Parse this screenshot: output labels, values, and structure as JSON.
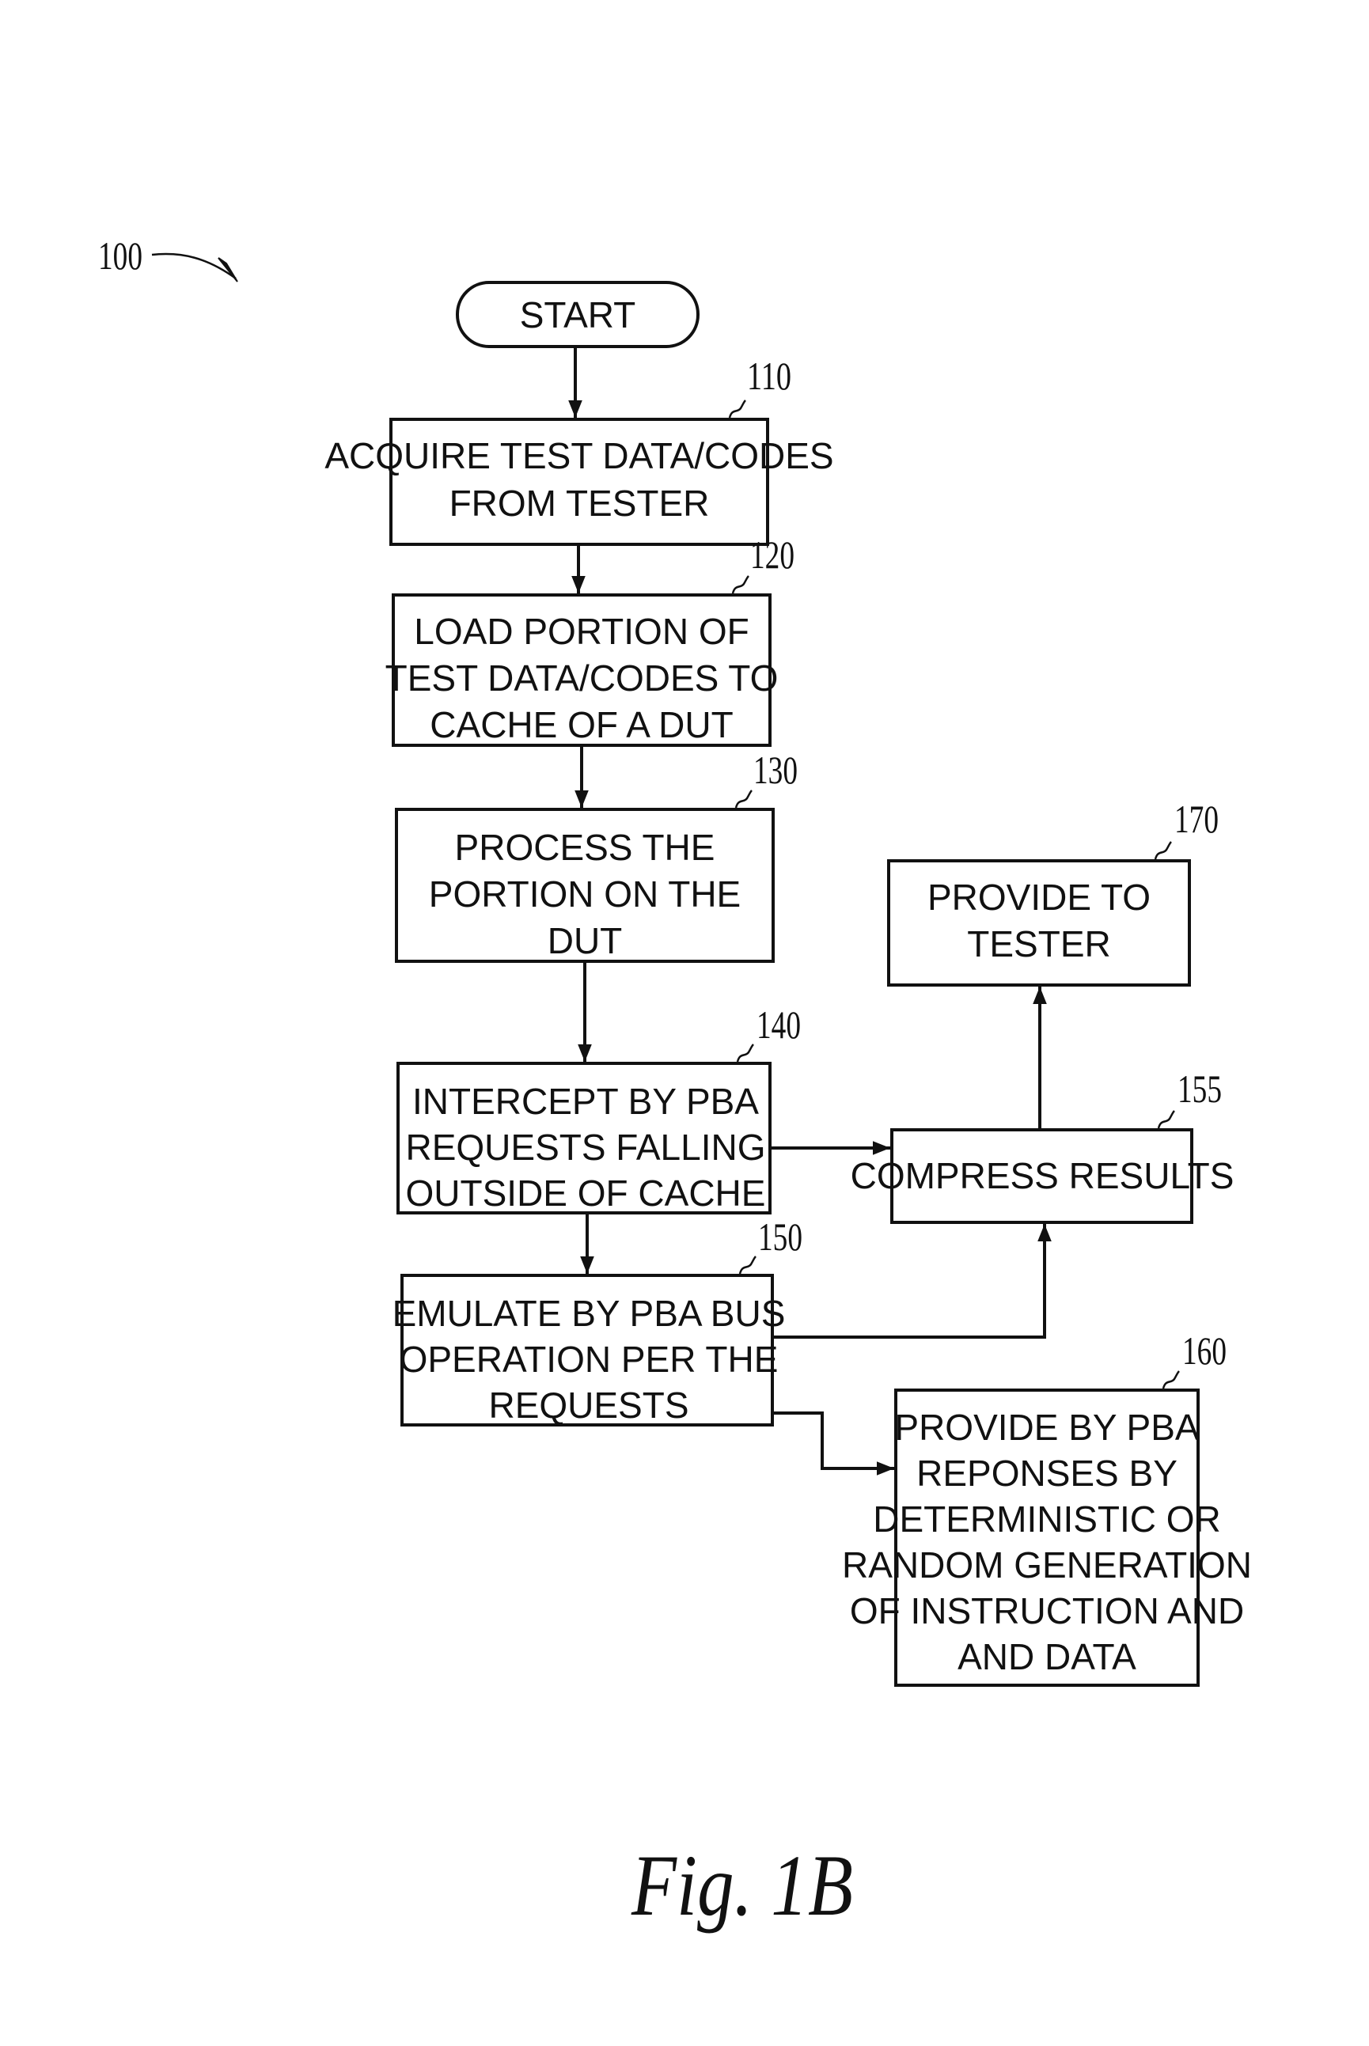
{
  "figure": {
    "reference": "100",
    "caption": "Fig. 1B"
  },
  "nodes": {
    "start": {
      "type": "terminal",
      "lines": [
        "START"
      ]
    },
    "n110": {
      "ref": "110",
      "lines": [
        "ACQUIRE TEST DATA/CODES",
        "FROM TESTER"
      ]
    },
    "n120": {
      "ref": "120",
      "lines": [
        "LOAD PORTION OF",
        "TEST DATA/CODES TO",
        "CACHE OF A DUT"
      ]
    },
    "n130": {
      "ref": "130",
      "lines": [
        "PROCESS THE",
        "PORTION ON THE",
        "DUT"
      ]
    },
    "n140": {
      "ref": "140",
      "lines": [
        "INTERCEPT BY PBA",
        "REQUESTS FALLING",
        "OUTSIDE OF CACHE"
      ]
    },
    "n150": {
      "ref": "150",
      "lines": [
        "EMULATE BY PBA BUS",
        "OPERATION PER THE",
        "REQUESTS"
      ]
    },
    "n155": {
      "ref": "155",
      "lines": [
        "COMPRESS RESULTS"
      ]
    },
    "n160": {
      "ref": "160",
      "lines": [
        "PROVIDE BY PBA",
        "REPONSES BY",
        "DETERMINISTIC OR",
        "RANDOM GENERATION",
        "OF INSTRUCTION AND",
        "AND DATA"
      ]
    },
    "n170": {
      "ref": "170",
      "lines": [
        "PROVIDE TO",
        "TESTER"
      ]
    }
  },
  "edges": [
    {
      "from": "start",
      "to": "n110"
    },
    {
      "from": "n110",
      "to": "n120"
    },
    {
      "from": "n120",
      "to": "n130"
    },
    {
      "from": "n130",
      "to": "n140"
    },
    {
      "from": "n140",
      "to": "n150"
    },
    {
      "from": "n140",
      "to": "n155"
    },
    {
      "from": "n150",
      "to": "n155"
    },
    {
      "from": "n150",
      "to": "n160"
    },
    {
      "from": "n155",
      "to": "n170"
    }
  ]
}
